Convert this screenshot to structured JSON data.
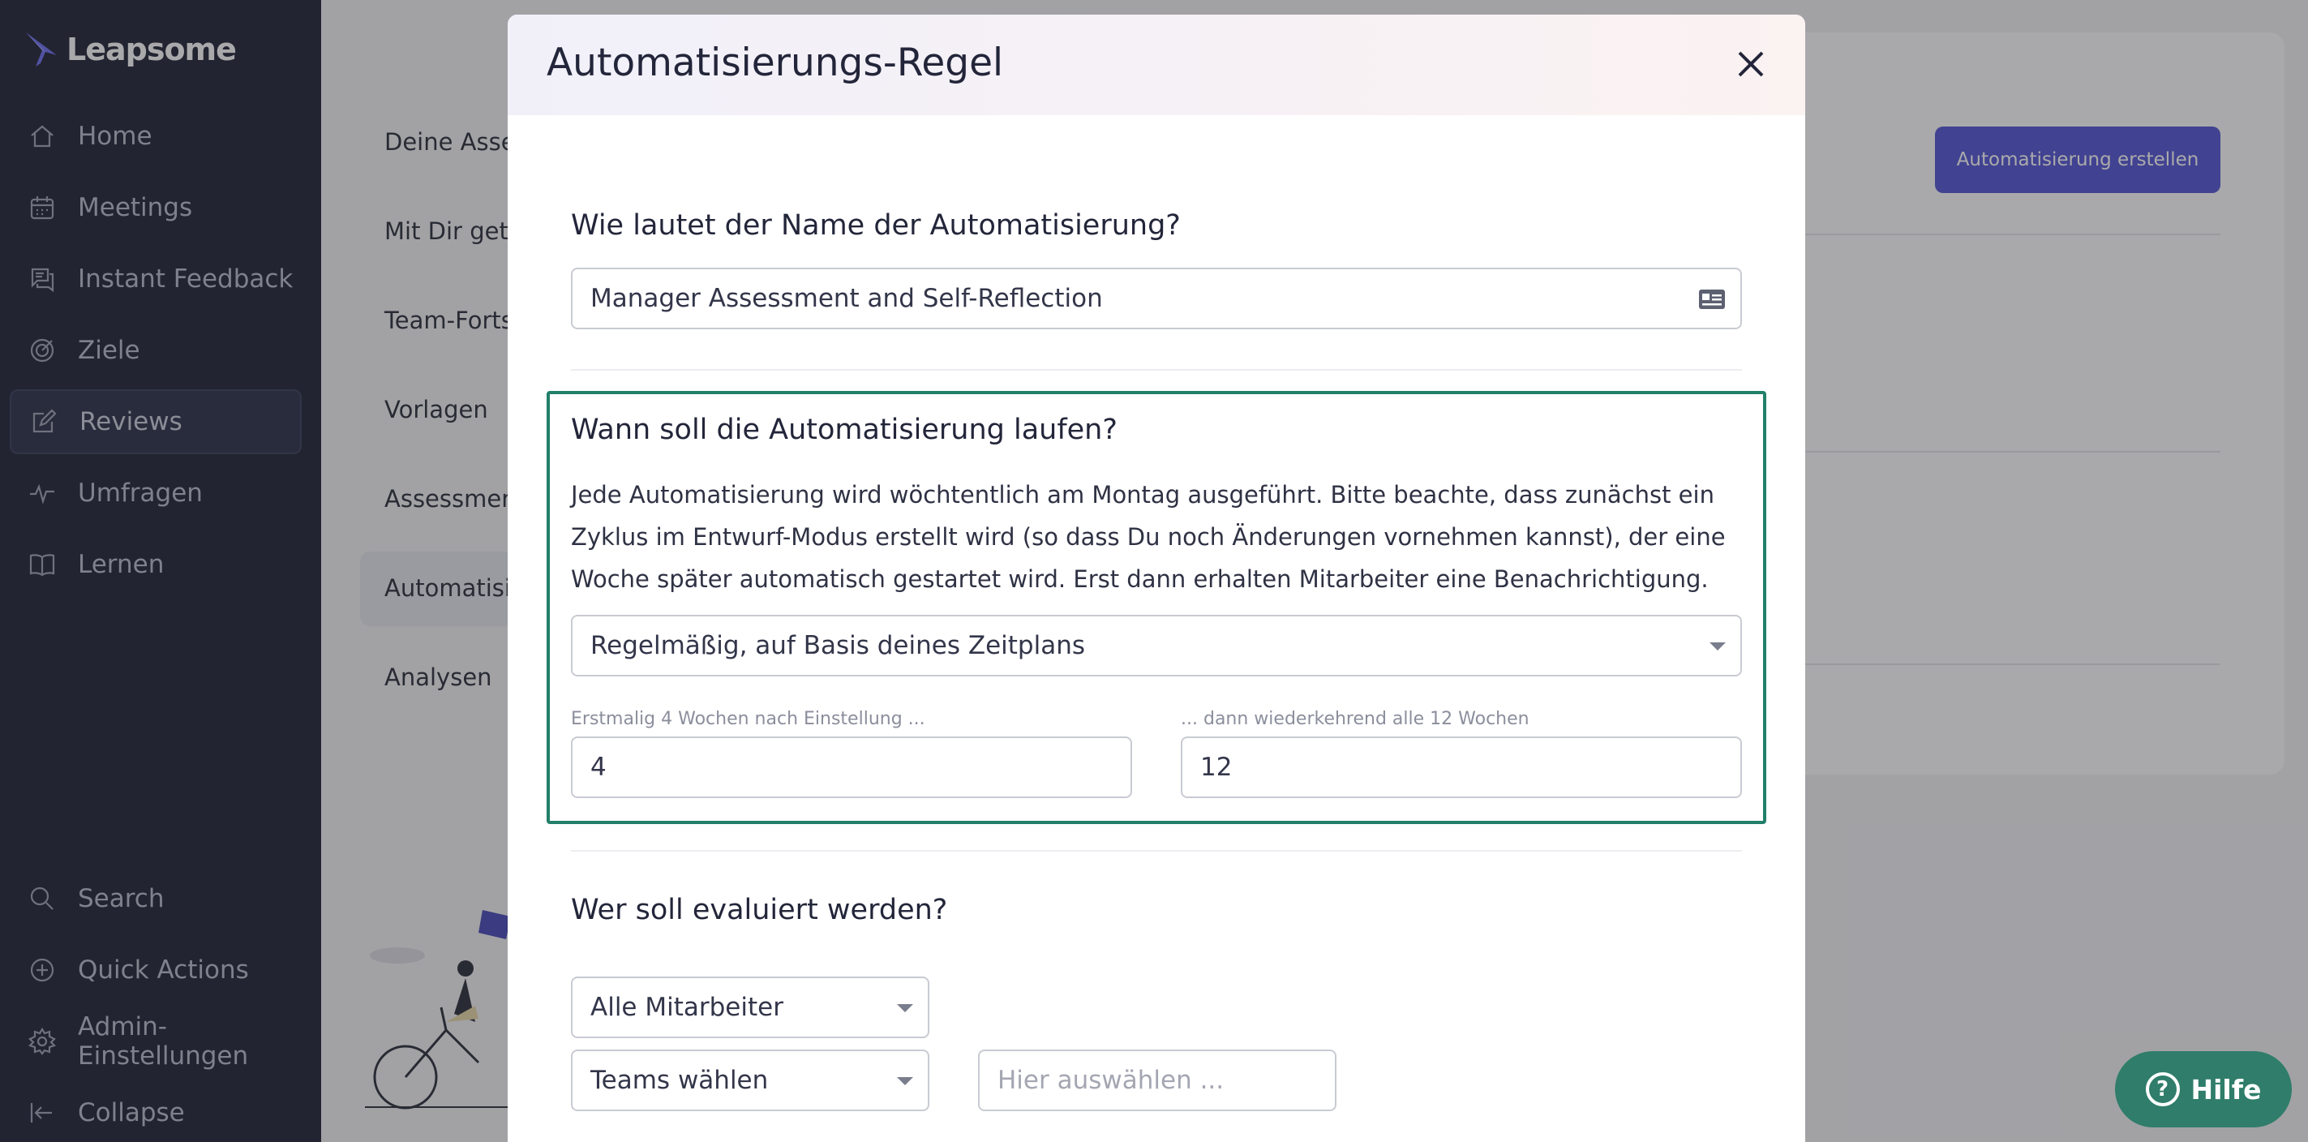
{
  "brand": {
    "name": "Leapsome"
  },
  "sidebar": {
    "items": [
      {
        "label": "Home",
        "icon": "home-icon"
      },
      {
        "label": "Meetings",
        "icon": "calendar-icon"
      },
      {
        "label": "Instant Feedback",
        "icon": "chat-icon"
      },
      {
        "label": "Ziele",
        "icon": "target-icon"
      },
      {
        "label": "Reviews",
        "icon": "edit-icon",
        "active": true
      },
      {
        "label": "Umfragen",
        "icon": "pulse-icon"
      },
      {
        "label": "Lernen",
        "icon": "book-icon"
      }
    ],
    "bottom_items": [
      {
        "label": "Search",
        "icon": "search-icon"
      },
      {
        "label": "Quick Actions",
        "icon": "plus-circle-icon"
      },
      {
        "label": "Admin-Einstellungen",
        "icon": "gear-icon"
      },
      {
        "label": "Collapse",
        "icon": "collapse-icon"
      }
    ]
  },
  "subnav": {
    "items": [
      "Deine Asses",
      "Mit Dir gete",
      "Team-Forts",
      "Vorlagen",
      "Assessment",
      "Automatisie",
      "Analysen"
    ],
    "active_index": 5
  },
  "page": {
    "create_button": "Automatisierung erstellen"
  },
  "modal": {
    "title": "Automatisierungs-Regel",
    "name_section": {
      "title": "Wie lautet der Name der Automatisierung?",
      "value": "Manager Assessment and Self-Reflection"
    },
    "schedule_section": {
      "title": "Wann soll die Automatisierung laufen?",
      "description": "Jede Automatisierung wird wöchtentlich am Montag ausgeführt. Bitte beachte, dass zunächst ein Zyklus im Entwurf-Modus erstellt wird (so dass Du noch Änderungen vornehmen kannst), der eine Woche später automatisch gestartet wird. Erst dann erhalten Mitarbeiter eine Benachrichtigung.",
      "schedule_select": "Regelmäßig, auf Basis deines Zeitplans",
      "first_label": "Erstmalig 4 Wochen nach Einstellung ...",
      "first_value": "4",
      "repeat_label": "... dann wiederkehrend alle 12 Wochen",
      "repeat_value": "12"
    },
    "evaluate_section": {
      "title": "Wer soll evaluiert werden?",
      "employees_select": "Alle Mitarbeiter",
      "teams_select": "Teams wählen",
      "teams_placeholder": "Hier auswählen ..."
    }
  },
  "help": {
    "label": "Hilfe"
  },
  "colors": {
    "sidebar_bg": "#1f2235",
    "accent": "#5254d4",
    "highlight_border": "#22806a",
    "help_bg": "#2f7d6a"
  }
}
